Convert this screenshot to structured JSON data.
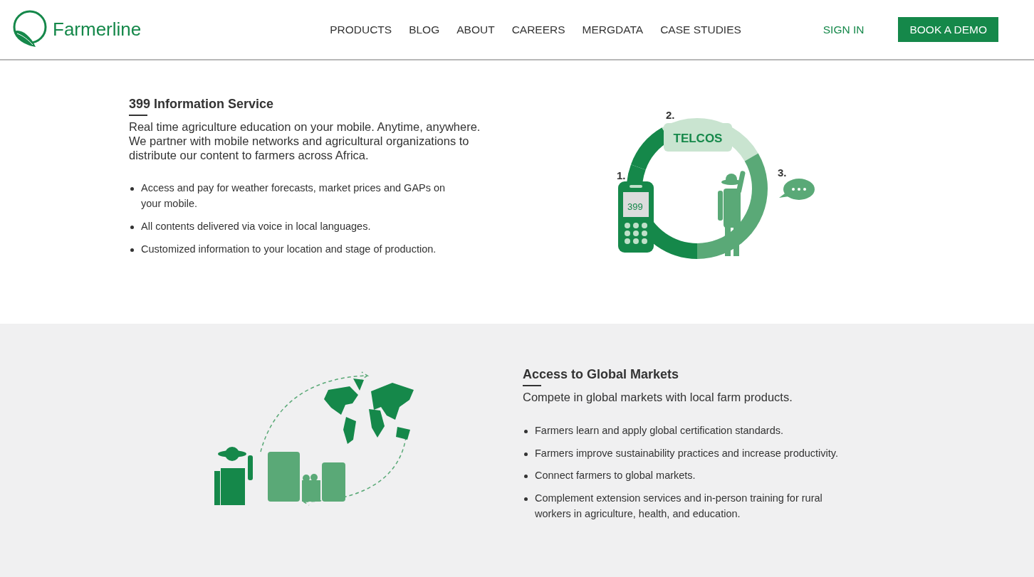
{
  "header": {
    "logo": "Farmerline",
    "nav": [
      {
        "label": "PRODUCTS"
      },
      {
        "label": "BLOG"
      },
      {
        "label": "ABOUT"
      },
      {
        "label": "CAREERS"
      },
      {
        "label": "MERGDATA"
      },
      {
        "label": "CASE STUDIES"
      }
    ],
    "sign_in": "SIGN IN",
    "cta": "BOOK A DEMO"
  },
  "sections": [
    {
      "kind": "telcos",
      "title": "399 Information Service",
      "lead": "Real time agriculture education on your mobile. Anytime, anywhere. We partner with mobile networks and agricultural organizations to distribute our content to farmers across Africa.",
      "bullets": [
        "Access and pay for weather forecasts, market prices and GAPs on your mobile.",
        "All contents delivered via voice in local languages.",
        "Customized information to your location and stage of production."
      ],
      "diagram": {
        "step_1": "1.",
        "step_2": "2.",
        "step_3": "3.",
        "hub": "TELCOS",
        "short_code": "399"
      }
    },
    {
      "kind": "markets",
      "title": "Access to Global Markets",
      "lead": "Compete in global markets with local farm products.",
      "bullets": [
        "Farmers learn and apply global certification standards.",
        "Farmers improve sustainability practices and increase productivity.",
        "Connect farmers to global markets.",
        "Complement extension services and in-person training for rural workers in agriculture, health, and education."
      ]
    }
  ]
}
